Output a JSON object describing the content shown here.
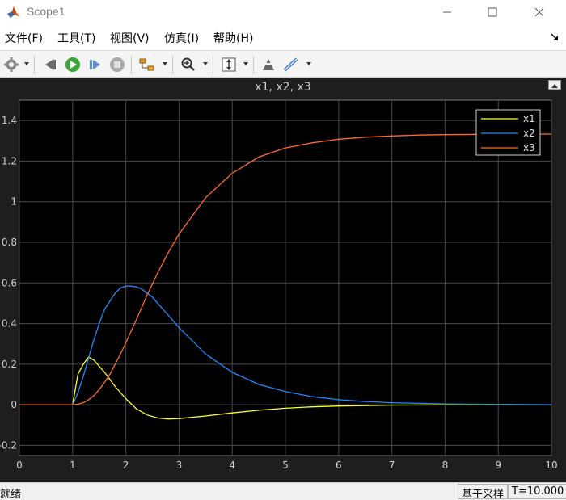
{
  "window": {
    "title": "Scope1",
    "icon": "matlab-icon"
  },
  "menu": {
    "items": [
      "文件(F)",
      "工具(T)",
      "视图(V)",
      "仿真(I)",
      "帮助(H)"
    ]
  },
  "toolbar": {
    "icons": [
      "gear-icon",
      "step-back-icon",
      "run-icon",
      "step-forward-icon",
      "stop-icon",
      "signal-select-icon",
      "zoom-icon",
      "autoscale-icon",
      "highlight-block-icon",
      "measurement-icon"
    ]
  },
  "colors": {
    "x1": "#ffff2a",
    "x2": "#1f8bff",
    "x3": "#ff6b2e",
    "plot_bg": "#000000",
    "frame_bg": "#1e1e1e",
    "grid": "#4a4a4a"
  },
  "chart_data": {
    "type": "line",
    "title": "x1, x2, x3",
    "xlim": [
      0,
      10
    ],
    "ylim": [
      -0.25,
      1.5
    ],
    "xticks": [
      0,
      1,
      2,
      3,
      4,
      5,
      6,
      7,
      8,
      9,
      10
    ],
    "yticks": [
      -0.2,
      0,
      0.2,
      0.4,
      0.6,
      0.8,
      1,
      1.2,
      1.4
    ],
    "ytick_labels": [
      "-0.2",
      "0",
      "0.2",
      "0.4",
      "0.6",
      "0.8",
      "1",
      "1.2",
      "1.4"
    ],
    "grid": true,
    "legend": "top-right",
    "series": [
      {
        "name": "x1",
        "x": [
          0,
          1.0,
          1.1,
          1.2,
          1.3,
          1.4,
          1.5,
          1.6,
          1.8,
          2.0,
          2.2,
          2.4,
          2.6,
          2.8,
          3.0,
          3.5,
          4.0,
          4.5,
          5.0,
          5.5,
          6.0,
          7.0,
          8.0,
          9.0,
          10.0
        ],
        "y": [
          0,
          0,
          0.15,
          0.2,
          0.235,
          0.22,
          0.19,
          0.16,
          0.09,
          0.03,
          -0.02,
          -0.05,
          -0.065,
          -0.07,
          -0.068,
          -0.055,
          -0.04,
          -0.027,
          -0.017,
          -0.01,
          -0.006,
          -0.002,
          -0.001,
          0,
          0
        ]
      },
      {
        "name": "x2",
        "x": [
          0,
          1.0,
          1.1,
          1.2,
          1.3,
          1.4,
          1.5,
          1.6,
          1.7,
          1.8,
          1.9,
          2.0,
          2.1,
          2.2,
          2.3,
          2.5,
          2.7,
          3.0,
          3.5,
          4.0,
          4.5,
          5.0,
          5.5,
          6.0,
          6.5,
          7.0,
          8.0,
          9.0,
          10.0
        ],
        "y": [
          0,
          0,
          0.06,
          0.14,
          0.23,
          0.32,
          0.4,
          0.47,
          0.51,
          0.55,
          0.575,
          0.585,
          0.585,
          0.58,
          0.57,
          0.53,
          0.47,
          0.38,
          0.25,
          0.16,
          0.1,
          0.065,
          0.04,
          0.025,
          0.016,
          0.01,
          0.004,
          0.002,
          0
        ]
      },
      {
        "name": "x3",
        "x": [
          0,
          1.0,
          1.1,
          1.2,
          1.3,
          1.4,
          1.5,
          1.6,
          1.7,
          1.8,
          1.9,
          2.0,
          2.2,
          2.4,
          2.6,
          2.8,
          3.0,
          3.5,
          4.0,
          4.5,
          5.0,
          5.5,
          6.0,
          6.5,
          7.0,
          7.5,
          8.0,
          9.0,
          10.0
        ],
        "y": [
          0,
          0,
          0.003,
          0.01,
          0.025,
          0.045,
          0.075,
          0.11,
          0.15,
          0.2,
          0.25,
          0.305,
          0.42,
          0.54,
          0.65,
          0.75,
          0.84,
          1.02,
          1.14,
          1.22,
          1.265,
          1.29,
          1.308,
          1.318,
          1.324,
          1.328,
          1.33,
          1.332,
          1.333
        ]
      }
    ]
  },
  "status": {
    "left": "就绪",
    "mode": "基于采样",
    "time": "T=10.000"
  }
}
